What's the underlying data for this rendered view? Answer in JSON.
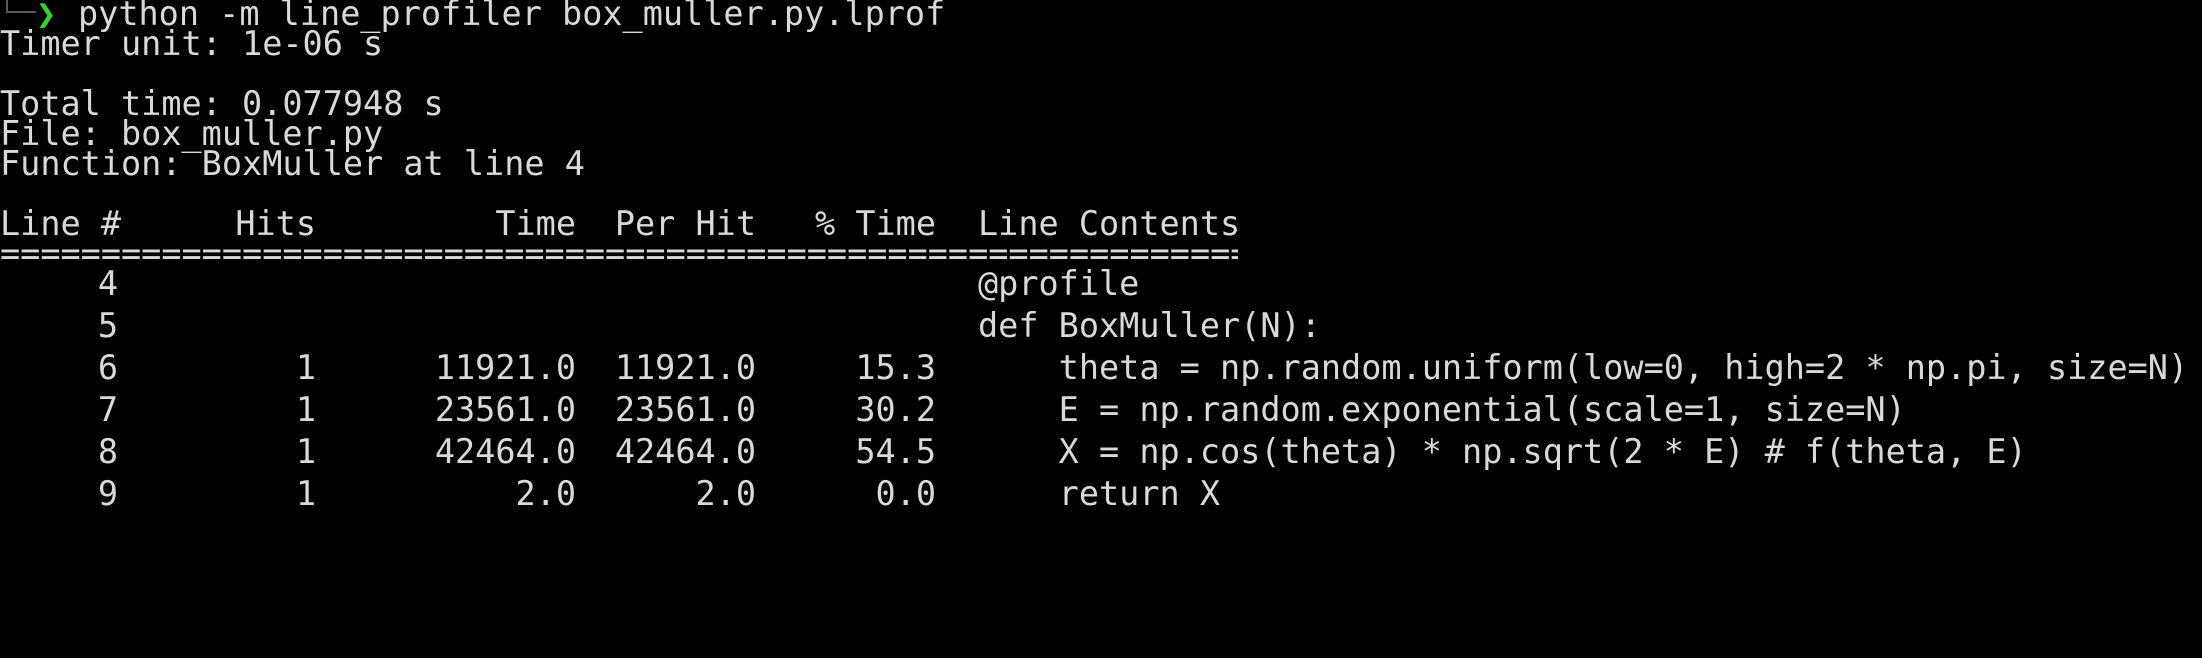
{
  "prompt": {
    "symbol": "❯",
    "command": "python -m line_profiler box_muller.py.lprof"
  },
  "info": {
    "timer_unit": "Timer unit: 1e-06 s",
    "total_time": "Total time: 0.077948 s",
    "file": "File: box_muller.py",
    "function": "Function: BoxMuller at line 4"
  },
  "table": {
    "headers": {
      "line_no": "Line #",
      "hits": "Hits",
      "time": "Time",
      "per_hit": "Per Hit",
      "pct_time": "% Time",
      "contents": "Line Contents"
    },
    "separator": "==============================================================",
    "rows": [
      {
        "line_no": "4",
        "hits": "",
        "time": "",
        "per_hit": "",
        "pct_time": "",
        "contents": "@profile"
      },
      {
        "line_no": "5",
        "hits": "",
        "time": "",
        "per_hit": "",
        "pct_time": "",
        "contents": "def BoxMuller(N):"
      },
      {
        "line_no": "6",
        "hits": "1",
        "time": "11921.0",
        "per_hit": "11921.0",
        "pct_time": "15.3",
        "contents": "    theta = np.random.uniform(low=0, high=2 * np.pi, size=N)"
      },
      {
        "line_no": "7",
        "hits": "1",
        "time": "23561.0",
        "per_hit": "23561.0",
        "pct_time": "30.2",
        "contents": "    E = np.random.exponential(scale=1, size=N)"
      },
      {
        "line_no": "8",
        "hits": "1",
        "time": "42464.0",
        "per_hit": "42464.0",
        "pct_time": "54.5",
        "contents": "    X = np.cos(theta) * np.sqrt(2 * E) # f(theta, E)"
      },
      {
        "line_no": "9",
        "hits": "1",
        "time": "2.0",
        "per_hit": "2.0",
        "pct_time": "0.0",
        "contents": "    return X"
      }
    ]
  },
  "colors": {
    "background": "#000000",
    "text": "#d9d9d9",
    "prompt_accent": "#2fd32f"
  }
}
